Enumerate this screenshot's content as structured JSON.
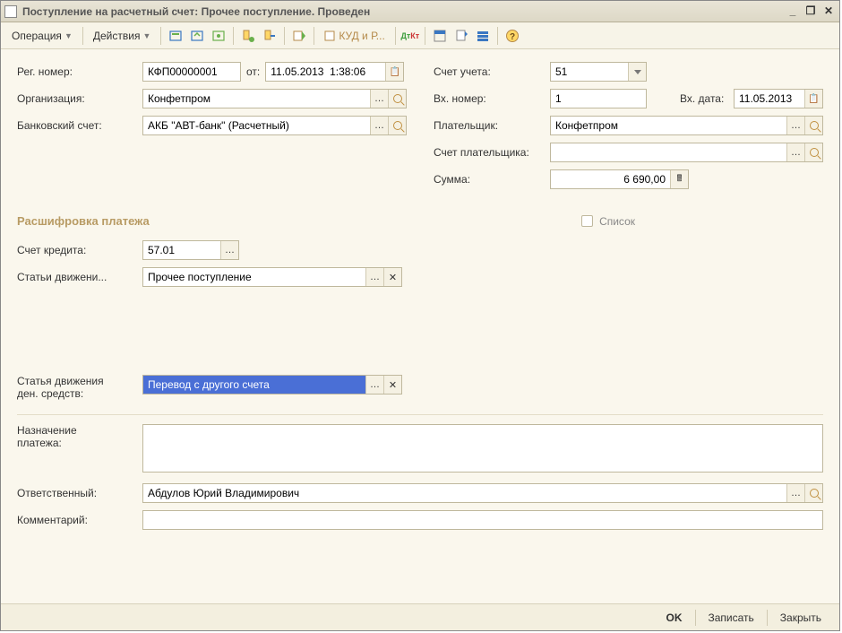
{
  "window_title": "Поступление на расчетный счет: Прочее поступление. Проведен",
  "menu": {
    "operation": "Операция",
    "actions": "Действия",
    "kudir": "КУД и Р..."
  },
  "left": {
    "reg_number_label": "Рег. номер:",
    "reg_number": "КФП00000001",
    "from_label": "от:",
    "datetime": "11.05.2013  1:38:06",
    "org_label": "Организация:",
    "org": "Конфетпром",
    "bank_label": "Банковский счет:",
    "bank": "АКБ \"АВТ-банк\" (Расчетный)"
  },
  "right": {
    "account_label": "Счет учета:",
    "account": "51",
    "in_no_label": "Вх. номер:",
    "in_no": "1",
    "in_date_label": "Вх. дата:",
    "in_date": "11.05.2013",
    "payer_label": "Плательщик:",
    "payer": "Конфетпром",
    "payer_acct_label": "Счет плательщика:",
    "payer_acct": "",
    "sum_label": "Сумма:",
    "sum": "6 690,00"
  },
  "section": {
    "title": "Расшифровка платежа",
    "list_label": "Список",
    "credit_label": "Счет кредита:",
    "credit": "57.01",
    "move_label": "Статьи движени...",
    "move": "Прочее поступление",
    "dds_label1": "Статья движения",
    "dds_label2": "ден. средств:",
    "dds": "Перевод с другого счета"
  },
  "bottom": {
    "purpose_label1": "Назначение",
    "purpose_label2": "платежа:",
    "purpose": "",
    "responsible_label": "Ответственный:",
    "responsible": "Абдулов Юрий Владимирович",
    "comment_label": "Комментарий:",
    "comment": ""
  },
  "footer": {
    "ok": "OK",
    "save": "Записать",
    "close": "Закрыть"
  }
}
